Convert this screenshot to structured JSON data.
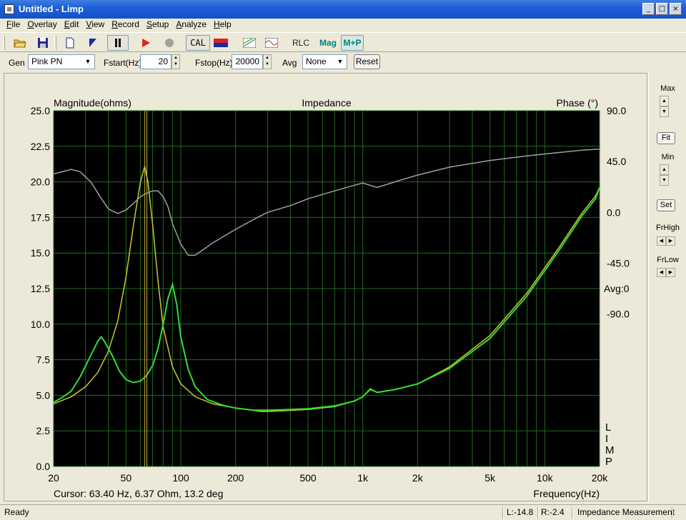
{
  "window": {
    "title": "Untitled - Limp",
    "min": "_",
    "max": "□",
    "close": "×"
  },
  "menu": [
    {
      "label": "File",
      "hot": "F",
      "rest": "ile"
    },
    {
      "label": "Overlay",
      "hot": "O",
      "rest": "verlay"
    },
    {
      "label": "Edit",
      "hot": "E",
      "rest": "dit"
    },
    {
      "label": "View",
      "hot": "V",
      "rest": "iew"
    },
    {
      "label": "Record",
      "hot": "R",
      "rest": "ecord"
    },
    {
      "label": "Setup",
      "hot": "S",
      "rest": "etup"
    },
    {
      "label": "Analyze",
      "hot": "A",
      "rest": "nalyze"
    },
    {
      "label": "Help",
      "hot": "H",
      "rest": "elp"
    }
  ],
  "toolbar": {
    "cal_label": "CAL",
    "rlc_label": "RLC",
    "mag_label": "Mag",
    "mp_label": "M+P",
    "accent_red": "#e02020",
    "accent_teal": "#008080"
  },
  "params": {
    "gen_label": "Gen",
    "gen_value": "Pink PN",
    "fstart_label": "Fstart(Hz)",
    "fstart_value": "20",
    "fstop_label": "Fstop(Hz)",
    "fstop_value": "20000",
    "avg_label": "Avg",
    "avg_value": "None",
    "reset_label": "Reset"
  },
  "side": {
    "max_label": "Max",
    "fit_label": "Fit",
    "min_label": "Min",
    "set_label": "Set",
    "frhigh_label": "FrHigh",
    "frlow_label": "FrLow"
  },
  "status": {
    "ready": "Ready",
    "l_value": "L:-14.8",
    "r_value": "R:-2.4",
    "mode": "Impedance Measurement"
  },
  "chart_data": {
    "type": "line",
    "title": "Impedance",
    "ylabel": "Magnitude(ohms)",
    "y2label": "Phase (°)",
    "xlabel": "Frequency(Hz)",
    "xscale": "log",
    "xlim": [
      20,
      20000
    ],
    "ylim": [
      0,
      25
    ],
    "y2lim": [
      -225,
      90
    ],
    "x_ticks": [
      20,
      50,
      100,
      200,
      500,
      1000,
      2000,
      5000,
      10000,
      20000
    ],
    "x_tick_labels": [
      "20",
      "50",
      "100",
      "200",
      "500",
      "1k",
      "2k",
      "5k",
      "10k",
      "20k"
    ],
    "y_ticks": [
      0,
      2.5,
      5,
      7.5,
      10,
      12.5,
      15,
      17.5,
      20,
      22.5,
      25
    ],
    "y_tick_labels": [
      "0.0",
      "2.5",
      "5.0",
      "7.5",
      "10.0",
      "12.5",
      "15.0",
      "17.5",
      "20.0",
      "22.5",
      "25.0"
    ],
    "y2_ticks": [
      90,
      45,
      0,
      -45,
      -90
    ],
    "y2_tick_labels": [
      "90.0",
      "45.0",
      "0.0",
      "-45.0",
      "-90.0"
    ],
    "avg_label": "Avg:0",
    "cursor_text": "Cursor: 63.40 Hz, 6.37 Ohm, 13.2 deg",
    "cursor_x": 63.4,
    "side_letters": [
      "L",
      "I",
      "M",
      "P"
    ],
    "grid": true,
    "background": "#000000",
    "grid_color": "#1f6b1f",
    "series": [
      {
        "role": "overlay-magnitude",
        "color": "#c8c832",
        "points": [
          [
            20,
            4.4
          ],
          [
            25,
            4.9
          ],
          [
            30,
            5.6
          ],
          [
            35,
            6.6
          ],
          [
            40,
            8.1
          ],
          [
            45,
            10.2
          ],
          [
            50,
            13.3
          ],
          [
            55,
            17.0
          ],
          [
            60,
            20.0
          ],
          [
            63.4,
            21.1
          ],
          [
            66,
            20.0
          ],
          [
            70,
            17.0
          ],
          [
            75,
            13.0
          ],
          [
            80,
            9.8
          ],
          [
            90,
            7.0
          ],
          [
            100,
            5.8
          ],
          [
            120,
            4.9
          ],
          [
            150,
            4.4
          ],
          [
            200,
            4.1
          ],
          [
            280,
            3.85
          ],
          [
            350,
            3.9
          ],
          [
            500,
            4.0
          ],
          [
            700,
            4.2
          ],
          [
            900,
            4.6
          ],
          [
            1000,
            4.9
          ],
          [
            1100,
            5.4
          ],
          [
            1200,
            5.2
          ],
          [
            1500,
            5.4
          ],
          [
            2000,
            5.8
          ],
          [
            3000,
            7.0
          ],
          [
            5000,
            9.2
          ],
          [
            8000,
            12.2
          ],
          [
            12000,
            15.4
          ],
          [
            16000,
            17.8
          ],
          [
            19000,
            19.0
          ],
          [
            20000,
            19.6
          ]
        ]
      },
      {
        "role": "magnitude",
        "color": "#33dd33",
        "points": [
          [
            20,
            4.5
          ],
          [
            22,
            4.8
          ],
          [
            25,
            5.3
          ],
          [
            28,
            6.3
          ],
          [
            32,
            7.8
          ],
          [
            35,
            8.8
          ],
          [
            36.5,
            9.1
          ],
          [
            38,
            8.8
          ],
          [
            42,
            7.8
          ],
          [
            46,
            6.7
          ],
          [
            50,
            6.1
          ],
          [
            55,
            5.9
          ],
          [
            60,
            6.0
          ],
          [
            65,
            6.4
          ],
          [
            70,
            7.1
          ],
          [
            75,
            8.3
          ],
          [
            80,
            10.0
          ],
          [
            85,
            11.8
          ],
          [
            90,
            12.8
          ],
          [
            95,
            11.4
          ],
          [
            100,
            9.1
          ],
          [
            110,
            6.8
          ],
          [
            120,
            5.6
          ],
          [
            140,
            4.7
          ],
          [
            170,
            4.3
          ],
          [
            200,
            4.1
          ],
          [
            250,
            3.95
          ],
          [
            300,
            3.95
          ],
          [
            400,
            4.0
          ],
          [
            500,
            4.05
          ],
          [
            700,
            4.25
          ],
          [
            900,
            4.6
          ],
          [
            1000,
            4.9
          ],
          [
            1100,
            5.45
          ],
          [
            1200,
            5.2
          ],
          [
            1500,
            5.4
          ],
          [
            2000,
            5.8
          ],
          [
            3000,
            6.9
          ],
          [
            5000,
            9.0
          ],
          [
            8000,
            12.0
          ],
          [
            12000,
            15.2
          ],
          [
            16000,
            17.6
          ],
          [
            19000,
            18.8
          ],
          [
            20000,
            19.6
          ]
        ]
      },
      {
        "role": "phase",
        "color": "#a0a0a0",
        "points": [
          [
            20,
            34
          ],
          [
            25,
            38
          ],
          [
            28,
            36
          ],
          [
            32,
            27
          ],
          [
            36,
            14
          ],
          [
            40,
            3
          ],
          [
            45,
            -1
          ],
          [
            50,
            2
          ],
          [
            55,
            8
          ],
          [
            60,
            14
          ],
          [
            65,
            17
          ],
          [
            70,
            19
          ],
          [
            75,
            19
          ],
          [
            80,
            14
          ],
          [
            85,
            5
          ],
          [
            90,
            -10
          ],
          [
            100,
            -28
          ],
          [
            110,
            -38
          ],
          [
            120,
            -38
          ],
          [
            150,
            -27
          ],
          [
            200,
            -15
          ],
          [
            260,
            -5
          ],
          [
            300,
            0
          ],
          [
            400,
            6
          ],
          [
            500,
            12
          ],
          [
            700,
            19
          ],
          [
            900,
            24
          ],
          [
            1000,
            26
          ],
          [
            1200,
            22
          ],
          [
            1500,
            27
          ],
          [
            2000,
            33
          ],
          [
            3000,
            40
          ],
          [
            5000,
            46
          ],
          [
            8000,
            50
          ],
          [
            12000,
            53
          ],
          [
            16000,
            55
          ],
          [
            20000,
            56
          ]
        ]
      }
    ]
  }
}
